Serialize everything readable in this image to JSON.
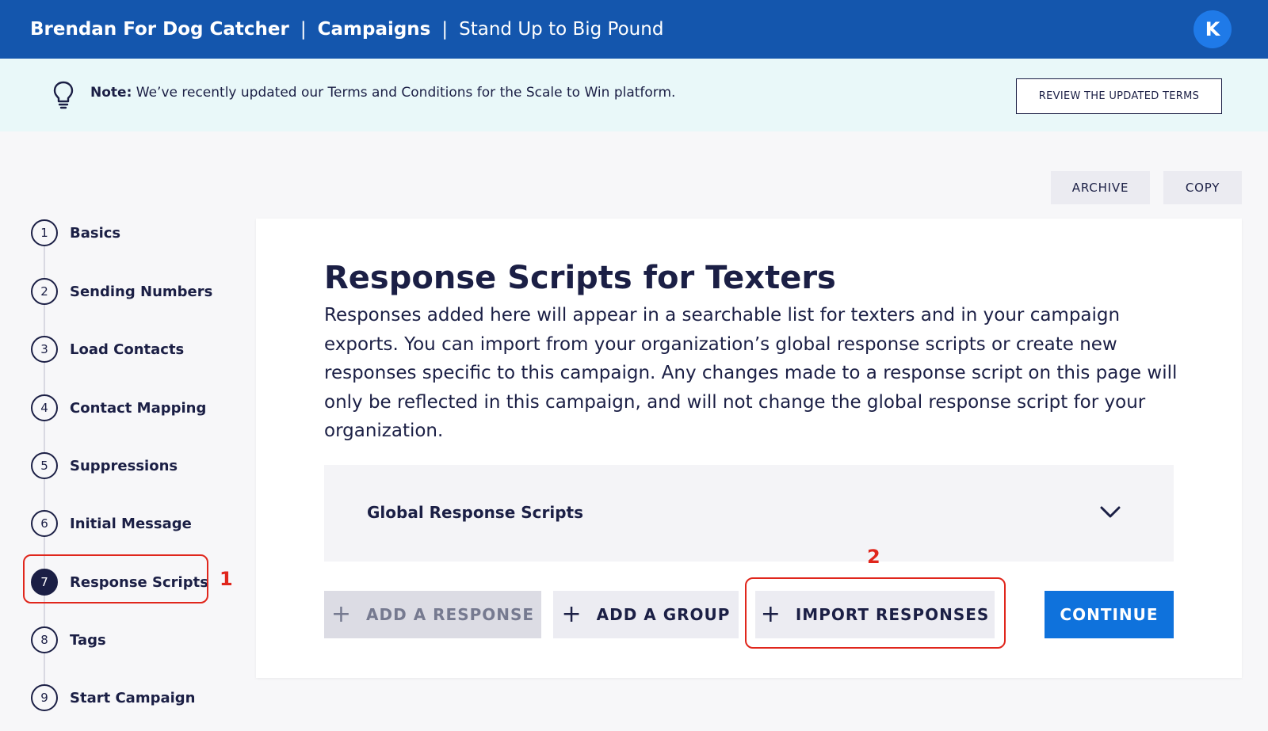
{
  "header": {
    "organization": "Brendan For Dog Catcher",
    "separator": "|",
    "section": "Campaigns",
    "campaign": "Stand Up to Big Pound",
    "avatar_initial": "K",
    "color": "#1456ad"
  },
  "notice": {
    "label": "Note:",
    "message": "We’ve recently updated our Terms and Conditions for the Scale to Win platform.",
    "button_label": "REVIEW THE UPDATED TERMS",
    "icon": "lightbulb-icon"
  },
  "actions": {
    "archive_label": "ARCHIVE",
    "copy_label": "COPY"
  },
  "steps": [
    {
      "number": "1",
      "label": "Basics"
    },
    {
      "number": "2",
      "label": "Sending Numbers"
    },
    {
      "number": "3",
      "label": "Load Contacts"
    },
    {
      "number": "4",
      "label": "Contact Mapping"
    },
    {
      "number": "5",
      "label": "Suppressions"
    },
    {
      "number": "6",
      "label": "Initial Message"
    },
    {
      "number": "7",
      "label": "Response Scripts",
      "active": true
    },
    {
      "number": "8",
      "label": "Tags"
    },
    {
      "number": "9",
      "label": "Start Campaign"
    }
  ],
  "annotations": {
    "marker_1": "1",
    "marker_2": "2",
    "color": "#e0261c"
  },
  "main": {
    "title": "Response Scripts for Texters",
    "description": "Responses added here will appear in a searchable list for texters and in your campaign exports. You can import from your organization’s global response scripts or create new responses specific to this campaign. Any changes made to a response script on this page will only be reflected in this campaign, and will not change the global response script for your organization.",
    "accordion_title": "Global Response Scripts",
    "add_response_label": "ADD A RESPONSE",
    "add_group_label": "ADD A GROUP",
    "import_responses_label": "IMPORT RESPONSES",
    "continue_label": "CONTINUE",
    "plus_glyph": "+",
    "accent_color": "#0f72dc"
  }
}
